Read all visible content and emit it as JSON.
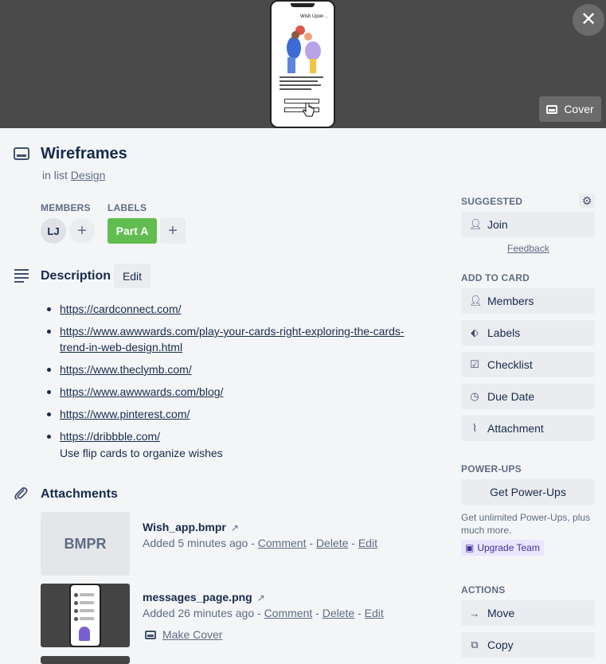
{
  "cover": {
    "thumbnail_title": "Wish Upon ..",
    "cover_button_label": "Cover",
    "close_icon": "close-icon"
  },
  "card": {
    "title": "Wireframes",
    "in_list_prefix": "in list",
    "list_name": "Design"
  },
  "members": {
    "label": "Members",
    "avatar_initials": "LJ"
  },
  "labels": {
    "label": "Labels",
    "items": [
      {
        "text": "Part A",
        "color": "#61bd4f"
      }
    ]
  },
  "description": {
    "title": "Description",
    "edit_label": "Edit",
    "links": [
      "https://cardconnect.com/",
      "https://www.awwwards.com/play-your-cards-right-exploring-the-cards-trend-in-web-design.html",
      "https://www.theclymb.com/",
      "https://www.awwwards.com/blog/",
      "https://www.pinterest.com/",
      "https://dribbble.com/"
    ],
    "note": "Use flip cards to organize wishes"
  },
  "attachments": {
    "title": "Attachments",
    "items": [
      {
        "thumb_text": "BMPR",
        "name": "Wish_app.bmpr",
        "added": "Added 5 minutes ago",
        "comment": "Comment",
        "delete": "Delete",
        "edit": "Edit"
      },
      {
        "name": "messages_page.png",
        "added": "Added 26 minutes ago",
        "comment": "Comment",
        "delete": "Delete",
        "edit": "Edit",
        "make_cover": "Make Cover"
      }
    ]
  },
  "sidebar": {
    "suggested_label": "Suggested",
    "join": "Join",
    "feedback": "Feedback",
    "add_to_card_label": "Add to card",
    "add_items": [
      "Members",
      "Labels",
      "Checklist",
      "Due Date",
      "Attachment"
    ],
    "powerups_label": "Power-Ups",
    "get_powerups": "Get Power-Ups",
    "powerups_note": "Get unlimited Power-Ups, plus much more.",
    "upgrade_team": "Upgrade Team",
    "actions_label": "Actions",
    "actions": [
      "Move",
      "Copy"
    ]
  }
}
